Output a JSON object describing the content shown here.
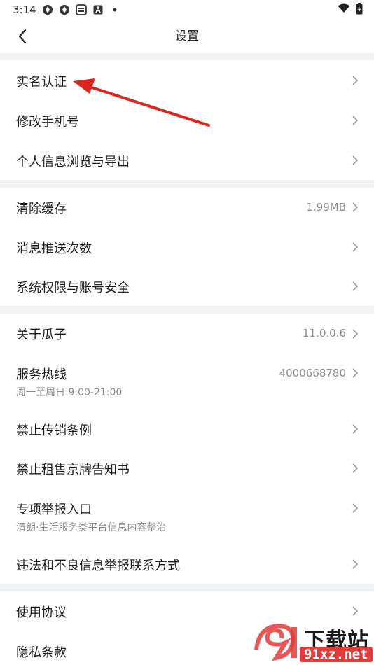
{
  "status_bar": {
    "time": "3:14",
    "icons": [
      "app-icon-1",
      "app-icon-2",
      "app-icon-3",
      "a-icon",
      "dot-icon"
    ],
    "right_icons": [
      "wifi-icon",
      "battery-icon"
    ]
  },
  "nav": {
    "title": "设置",
    "back_icon": "chevron-left-icon"
  },
  "sections": [
    {
      "items": [
        {
          "label": "实名认证"
        },
        {
          "label": "修改手机号"
        },
        {
          "label": "个人信息浏览与导出"
        }
      ]
    },
    {
      "items": [
        {
          "label": "清除缓存",
          "value": "1.99MB"
        },
        {
          "label": "消息推送次数"
        },
        {
          "label": "系统权限与账号安全"
        }
      ]
    },
    {
      "items": [
        {
          "label": "关于瓜子",
          "value": "11.0.0.6"
        },
        {
          "label": "服务热线",
          "value": "4000668780",
          "sub": "周一至周日 9:00-21:00"
        },
        {
          "label": "禁止传销条例"
        },
        {
          "label": "禁止租售京牌告知书"
        },
        {
          "label": "专项举报入口",
          "sub": "清朗·生活服务类平台信息内容整治"
        },
        {
          "label": "违法和不良信息举报联系方式"
        }
      ]
    },
    {
      "items": [
        {
          "label": "使用协议"
        },
        {
          "label": "隐私条款"
        }
      ]
    }
  ],
  "annotation": {
    "arrow_color": "#d9271d"
  },
  "watermark": {
    "brand": "下载站",
    "url": "91xz.net"
  }
}
